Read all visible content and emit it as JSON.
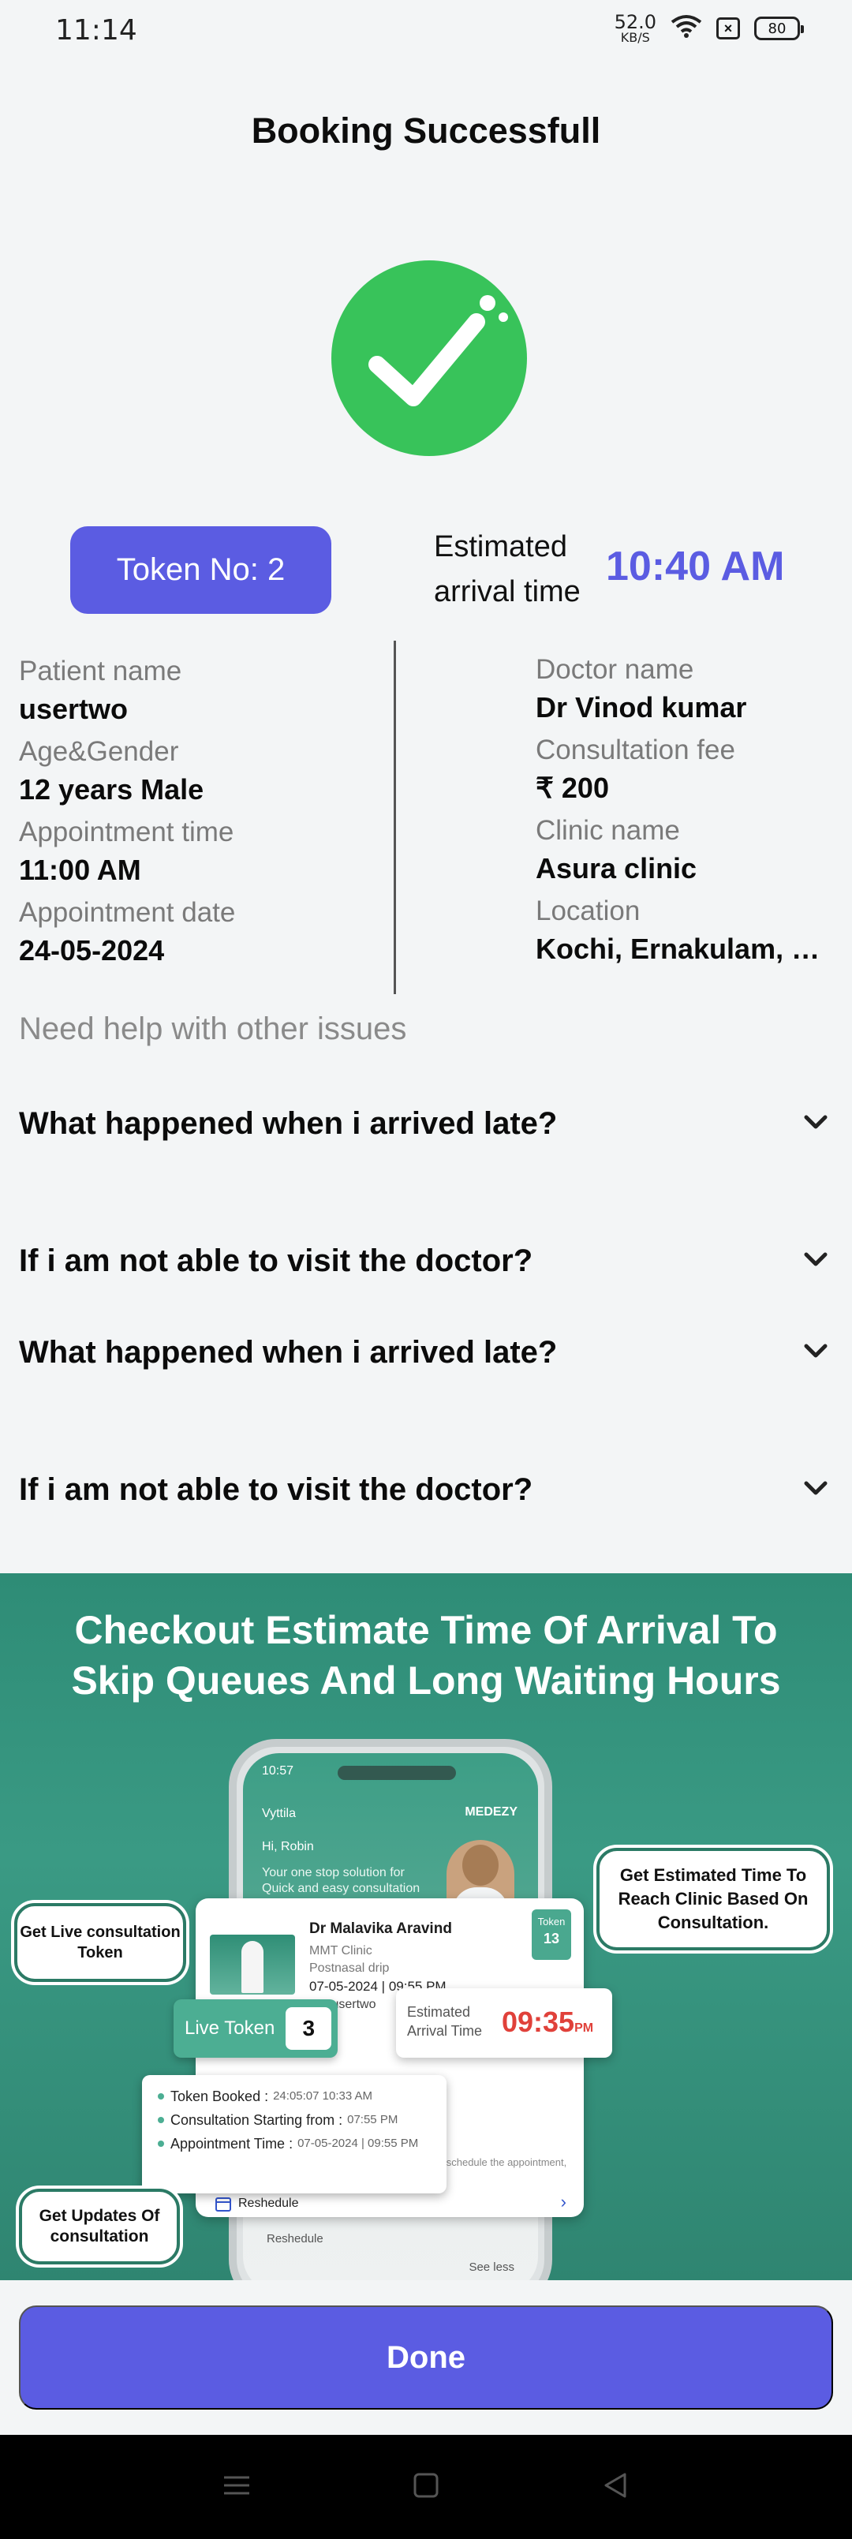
{
  "status_bar": {
    "time": "11:14",
    "net_speed_value": "52.0",
    "net_speed_unit": "KB/S",
    "battery": "80"
  },
  "page": {
    "title": "Booking Successfull"
  },
  "booking": {
    "token_label": "Token No: 2",
    "eta_label": "Estimated arrival time",
    "eta_value": "10:40 AM"
  },
  "details": {
    "left": [
      {
        "label": "Patient name",
        "value": "usertwo"
      },
      {
        "label": "Age&Gender",
        "value": "12 years Male"
      },
      {
        "label": "Appointment time",
        "value": "11:00 AM"
      },
      {
        "label": "Appointment date",
        "value": "24-05-2024"
      }
    ],
    "right": [
      {
        "label": "Doctor name",
        "value": "Dr Vinod kumar"
      },
      {
        "label": "Consultation fee",
        "value": "₹ 200"
      },
      {
        "label": "Clinic name",
        "value": "Asura clinic"
      },
      {
        "label": "Location",
        "value": " Kochi, Ernakulam, K…"
      }
    ]
  },
  "help": {
    "title": "Need help with other issues",
    "faqs": [
      {
        "question": "What happened when i arrived late?"
      },
      {
        "question": "If i am not able to visit the doctor?"
      },
      {
        "question": "What happened when i arrived late?"
      },
      {
        "question": "If i am not able to visit the doctor?"
      }
    ]
  },
  "banner": {
    "headline_line1": "Checkout Estimate Time Of Arrival To",
    "headline_line2": "Skip Queues And Long Waiting Hours",
    "phone": {
      "time": "10:57",
      "location": "Vyttila",
      "brand": "MEDEZY",
      "greeting": "Hi, Robin",
      "tagline": "Your one stop solution for Quick and easy consultation",
      "reschedule": "Reshedule",
      "see_less": "See less"
    },
    "card": {
      "doctor": "Dr Malavika Aravind",
      "clinic": "MMT Clinic",
      "condition": "Postnasal drip",
      "date": "07-05-2024 | 09:55 PM",
      "patient": "For usertwo",
      "token_label": "Token",
      "token_number": "13",
      "note": "in case you can't attend the appointment, please reschedule the appointment, preferably 5 hours before the shedule time.",
      "reschedule": "Reshedule"
    },
    "live_token": {
      "label": "Live Token",
      "number": "3"
    },
    "eta_card": {
      "label": "Estimated Arrival Time",
      "value": "09:35",
      "suffix": "PM"
    },
    "timeline": [
      {
        "label": "Token Booked :",
        "value": "24:05:07 10:33 AM"
      },
      {
        "label": "Consultation Starting from :",
        "value": "07:55 PM"
      },
      {
        "label": "Appointment Time :",
        "value": "07-05-2024 | 09:55 PM"
      }
    ],
    "bubbles": {
      "token": "Get Live consultation Token",
      "eta": "Get Estimated Time To Reach Clinic Based On Consultation.",
      "updates": "Get Updates Of consultation"
    }
  },
  "actions": {
    "done_label": "Done"
  },
  "colors": {
    "accent": "#5b5ce2",
    "success": "#38c35a",
    "banner": "#2e8c76",
    "eta_red": "#e0413a"
  }
}
